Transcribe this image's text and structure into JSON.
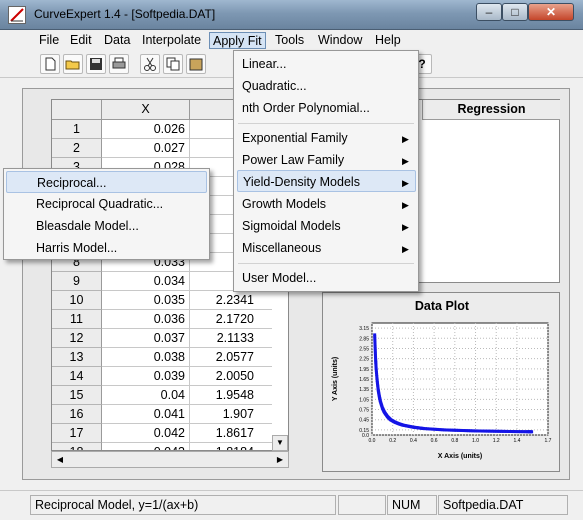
{
  "window": {
    "title": "CurveExpert 1.4 - [Softpedia.DAT]",
    "minimize_glyph": "–",
    "maximize_glyph": "□",
    "close_glyph": "✕"
  },
  "menubar": {
    "items": [
      "File",
      "Edit",
      "Data",
      "Interpolate",
      "Apply Fit",
      "Tools",
      "Window",
      "Help"
    ],
    "active": "Apply Fit"
  },
  "toolbar": {
    "icons": [
      "new-file-icon",
      "open-folder-icon",
      "save-icon",
      "print-icon",
      "cut-icon",
      "copy-icon",
      "paste-icon",
      "help-icon"
    ]
  },
  "grid": {
    "col_x": "X",
    "rows": [
      {
        "n": "1",
        "x": "0.026",
        "y": ""
      },
      {
        "n": "2",
        "x": "0.027",
        "y": ""
      },
      {
        "n": "3",
        "x": "0.028",
        "y": ""
      },
      {
        "n": "4",
        "x": "",
        "y": ""
      },
      {
        "n": "5",
        "x": "",
        "y": ""
      },
      {
        "n": "6",
        "x": "",
        "y": ""
      },
      {
        "n": "7",
        "x": "",
        "y": ""
      },
      {
        "n": "8",
        "x": "0.033",
        "y": ""
      },
      {
        "n": "9",
        "x": "0.034",
        "y": ""
      },
      {
        "n": "10",
        "x": "0.035",
        "y": "2.2341"
      },
      {
        "n": "11",
        "x": "0.036",
        "y": "2.1720"
      },
      {
        "n": "12",
        "x": "0.037",
        "y": "2.1133"
      },
      {
        "n": "13",
        "x": "0.038",
        "y": "2.0577"
      },
      {
        "n": "14",
        "x": "0.039",
        "y": "2.0050"
      },
      {
        "n": "15",
        "x": "0.04",
        "y": "1.9548"
      },
      {
        "n": "16",
        "x": "0.041",
        "y": "1.907"
      },
      {
        "n": "17",
        "x": "0.042",
        "y": "1.8617"
      },
      {
        "n": "18",
        "x": "0.043",
        "y": "1.8184"
      }
    ]
  },
  "regression": {
    "header": "Regression"
  },
  "plot": {
    "title": "Data Plot",
    "xlabel": "X Axis (units)",
    "ylabel": "Y Axis (units)",
    "color": "#1414e6"
  },
  "chart_data": {
    "type": "scatter",
    "title": "Data Plot",
    "xlabel": "X Axis (units)",
    "ylabel": "Y Axis (units)",
    "xlim": [
      0.0,
      1.7
    ],
    "ylim": [
      0.0,
      3.3
    ],
    "xticks": [
      "0.0",
      "0.2",
      "0.4",
      "0.6",
      "0.8",
      "1.0",
      "1.2",
      "1.4",
      "1.7"
    ],
    "yticks": [
      "0.0",
      "0.15",
      "0.45",
      "0.75",
      "1.05",
      "1.35",
      "1.65",
      "1.95",
      "2.25",
      "2.55",
      "2.85",
      "3.15"
    ],
    "series": [
      {
        "x": [
          0.026,
          0.03,
          0.035,
          0.04,
          0.05,
          0.06,
          0.07,
          0.08,
          0.1,
          0.12,
          0.15,
          0.18,
          0.22,
          0.26,
          0.3,
          0.35,
          0.4,
          0.45,
          0.5,
          0.6,
          0.7,
          0.8,
          0.9,
          1.0,
          1.1,
          1.2,
          1.3,
          1.4,
          1.5,
          1.55
        ],
        "y": [
          2.95,
          2.6,
          2.23,
          1.95,
          1.6,
          1.33,
          1.15,
          1.0,
          0.8,
          0.67,
          0.54,
          0.45,
          0.38,
          0.33,
          0.29,
          0.26,
          0.23,
          0.21,
          0.19,
          0.17,
          0.15,
          0.14,
          0.13,
          0.12,
          0.115,
          0.11,
          0.105,
          0.1,
          0.097,
          0.095
        ]
      }
    ],
    "grid": true
  },
  "apply_fit_menu": {
    "items": [
      {
        "label": "Linear...",
        "submenu": false
      },
      {
        "label": "Quadratic...",
        "submenu": false
      },
      {
        "label": "nth Order Polynomial...",
        "submenu": false
      },
      {
        "label": "Exponential Family",
        "submenu": true
      },
      {
        "label": "Power Law Family",
        "submenu": true
      },
      {
        "label": "Yield-Density Models",
        "submenu": true
      },
      {
        "label": "Growth Models",
        "submenu": true
      },
      {
        "label": "Sigmoidal Models",
        "submenu": true
      },
      {
        "label": "Miscellaneous",
        "submenu": true
      },
      {
        "label": "User Model...",
        "submenu": false
      }
    ]
  },
  "yield_submenu": {
    "items": [
      "Reciprocal...",
      "Reciprocal Quadratic...",
      "Bleasdale Model...",
      "Harris Model..."
    ]
  },
  "statusbar": {
    "message": "Reciprocal Model, y=1/(ax+b)",
    "num": "NUM",
    "file": "Softpedia.DAT"
  }
}
